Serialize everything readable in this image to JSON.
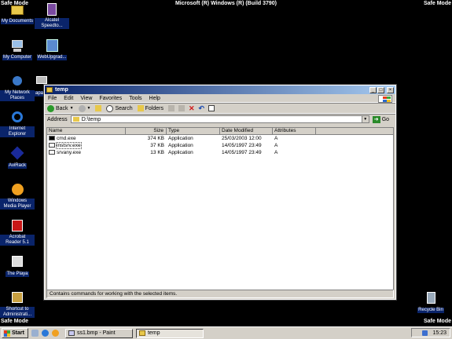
{
  "desktop": {
    "safe_mode_label": "Safe Mode",
    "os_title": "Microsoft (R) Windows (R) (Build 3790)",
    "icons": [
      {
        "label": "My Documents"
      },
      {
        "label": "Alcatel Speedto..."
      },
      {
        "label": "My Computer"
      },
      {
        "label": "WebUpgrad..."
      },
      {
        "label": "My Network Places"
      },
      {
        "label": "apa..."
      },
      {
        "label": "Internet Explorer"
      },
      {
        "label": "AviRack"
      },
      {
        "label": "Windows Media Player"
      },
      {
        "label": "Acrobat Reader 5.1"
      },
      {
        "label": "The Playa"
      },
      {
        "label": "Shortcut to Administrati..."
      },
      {
        "label": "Recycle Bin"
      }
    ]
  },
  "window": {
    "title": "temp",
    "menu": [
      "File",
      "Edit",
      "View",
      "Favorites",
      "Tools",
      "Help"
    ],
    "toolbar": {
      "back": "Back",
      "search": "Search",
      "folders": "Folders"
    },
    "address": {
      "label": "Address",
      "value": "D:\\temp",
      "go": "Go"
    },
    "columns": [
      "Name",
      "Size",
      "Type",
      "Date Modified",
      "Attributes"
    ],
    "files": [
      {
        "name": "cmd.exe",
        "size": "374 KB",
        "type": "Application",
        "date": "25/03/2003 12:00",
        "attr": "A"
      },
      {
        "name": "instsrv.exe",
        "size": "37 KB",
        "type": "Application",
        "date": "14/05/1997 23:49",
        "attr": "A"
      },
      {
        "name": "srvany.exe",
        "size": "13 KB",
        "type": "Application",
        "date": "14/05/1997 23:49",
        "attr": "A"
      }
    ],
    "status": "Contains commands for working with the selected items."
  },
  "taskbar": {
    "start": "Start",
    "tasks": [
      {
        "label": "ss1.bmp - Paint"
      },
      {
        "label": "temp"
      }
    ],
    "clock": "15:23"
  },
  "colors": {
    "desktop": "#000000",
    "titlebar": "#0a246a",
    "face": "#d4d0c8"
  }
}
